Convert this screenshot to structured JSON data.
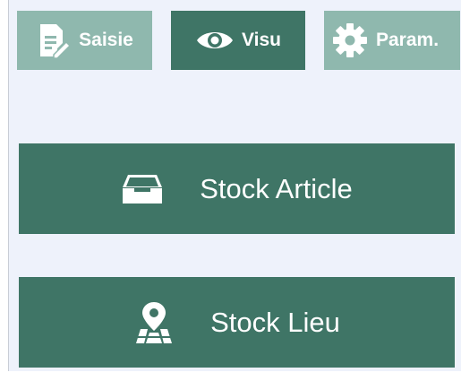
{
  "tabs": [
    {
      "label": "Saisie",
      "icon": "edit-document-icon",
      "active": false
    },
    {
      "label": "Visu",
      "icon": "eye-icon",
      "active": true
    },
    {
      "label": "Param.",
      "icon": "gear-icon",
      "active": false
    }
  ],
  "actions": [
    {
      "label": "Stock Article",
      "icon": "inbox-tray-icon"
    },
    {
      "label": "Stock Lieu",
      "icon": "map-pin-icon"
    }
  ],
  "colors": {
    "background": "#eef2fb",
    "primary": "#3f7566",
    "tab_inactive": "#8fb8ae",
    "text": "#ffffff"
  }
}
